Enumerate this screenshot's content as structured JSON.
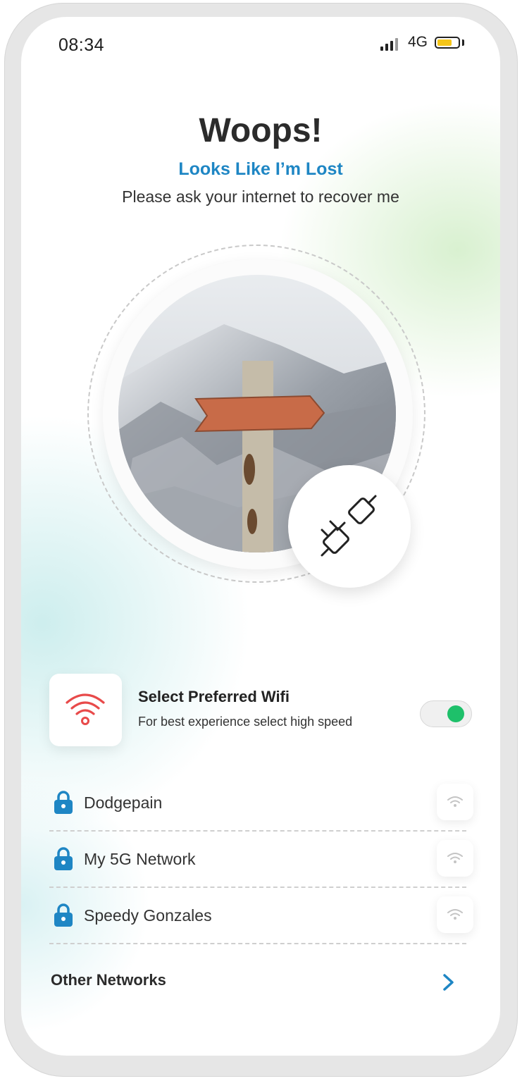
{
  "status_bar": {
    "time": "08:34",
    "network_type": "4G",
    "signal_icon": "cellular-signal-icon",
    "battery_icon": "battery-icon",
    "battery_color": "#f5c518"
  },
  "header": {
    "title": "Woops!",
    "subtitle": "Looks Like I’m Lost",
    "message": "Please ask your internet to recover me"
  },
  "illustration": {
    "photo": "signpost-photo",
    "badge_icon": "unplugged-icon"
  },
  "wifi_preference": {
    "icon": "wifi-icon",
    "icon_color": "#e84a4a",
    "title": "Select Preferred Wifi",
    "subtitle": "For best experience select high speed",
    "toggle_on": true,
    "toggle_color": "#1ec06a"
  },
  "networks": [
    {
      "name": "Dodgepain",
      "lock_icon": "lock-icon",
      "signal_icon": "wifi-signal-icon"
    },
    {
      "name": "My 5G Network",
      "lock_icon": "lock-icon",
      "signal_icon": "wifi-signal-icon"
    },
    {
      "name": "Speedy Gonzales",
      "lock_icon": "lock-icon",
      "signal_icon": "wifi-signal-icon"
    }
  ],
  "other_networks": {
    "label": "Other Networks",
    "icon": "chevron-right-icon"
  },
  "colors": {
    "accent": "#1e86c4",
    "title": "#2b2b2b"
  }
}
